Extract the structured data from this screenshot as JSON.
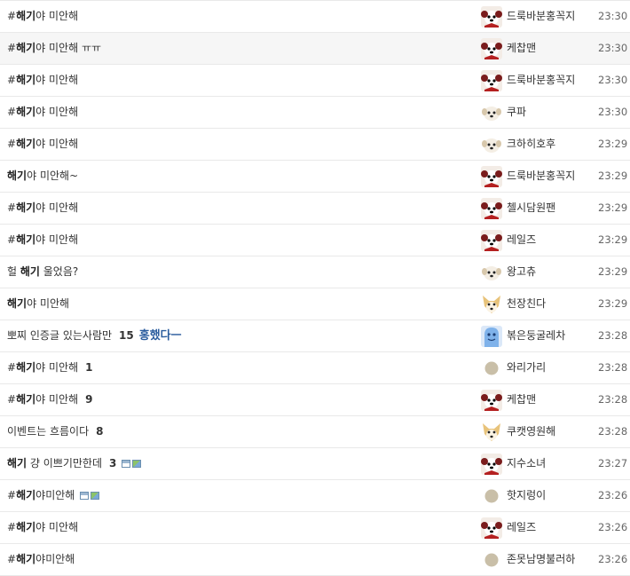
{
  "rows": [
    {
      "title": [
        {
          "t": "#"
        },
        {
          "t": "해기",
          "b": true
        },
        {
          "t": "야 미안해"
        }
      ],
      "count": "",
      "hot": "",
      "attach": false,
      "avatar": "dog-bow-icon",
      "nick": "드룩바분홍꼭지",
      "time": "23:30"
    },
    {
      "title": [
        {
          "t": "#"
        },
        {
          "t": "해기",
          "b": true
        },
        {
          "t": "야 미안해 ㅠㅠ"
        }
      ],
      "count": "",
      "hot": "",
      "attach": false,
      "avatar": "dog-bow-icon",
      "nick": "케찹맨",
      "time": "23:30",
      "hover": true
    },
    {
      "title": [
        {
          "t": "#"
        },
        {
          "t": "해기",
          "b": true
        },
        {
          "t": "야 미안해"
        }
      ],
      "count": "",
      "hot": "",
      "attach": false,
      "avatar": "dog-bow-icon",
      "nick": "드룩바분홍꼭지",
      "time": "23:30"
    },
    {
      "title": [
        {
          "t": "#"
        },
        {
          "t": "해기",
          "b": true
        },
        {
          "t": "야 미안해"
        }
      ],
      "count": "",
      "hot": "",
      "attach": false,
      "avatar": "puppy-icon",
      "nick": "쿠파",
      "time": "23:30"
    },
    {
      "title": [
        {
          "t": "#"
        },
        {
          "t": "해기",
          "b": true
        },
        {
          "t": "야 미안해"
        }
      ],
      "count": "",
      "hot": "",
      "attach": false,
      "avatar": "puppy-icon",
      "nick": "크하히호후",
      "time": "23:29"
    },
    {
      "title": [
        {
          "t": "해기",
          "b": true
        },
        {
          "t": "야 미안해~"
        }
      ],
      "count": "",
      "hot": "",
      "attach": false,
      "avatar": "dog-bow-icon",
      "nick": "드룩바분홍꼭지",
      "time": "23:29"
    },
    {
      "title": [
        {
          "t": "#"
        },
        {
          "t": "해기",
          "b": true
        },
        {
          "t": "야 미안해"
        }
      ],
      "count": "",
      "hot": "",
      "attach": false,
      "avatar": "dog-bow-icon",
      "nick": "첼시담원팬",
      "time": "23:29"
    },
    {
      "title": [
        {
          "t": "#"
        },
        {
          "t": "해기",
          "b": true
        },
        {
          "t": "야 미안해"
        }
      ],
      "count": "",
      "hot": "",
      "attach": false,
      "avatar": "dog-bow-icon",
      "nick": "레일즈",
      "time": "23:29"
    },
    {
      "title": [
        {
          "t": "헐 "
        },
        {
          "t": "해기",
          "b": true
        },
        {
          "t": " 울었음?"
        }
      ],
      "count": "",
      "hot": "",
      "attach": false,
      "avatar": "puppy-icon",
      "nick": "왕고츄",
      "time": "23:29"
    },
    {
      "title": [
        {
          "t": "해기",
          "b": true
        },
        {
          "t": "야 미안해"
        }
      ],
      "count": "",
      "hot": "",
      "attach": false,
      "avatar": "fox-dog-icon",
      "nick": "천장친다",
      "time": "23:29"
    },
    {
      "title": [
        {
          "t": "뽀찌 인증글 있는사람만"
        }
      ],
      "count": "15",
      "hot": "홍했다ㅡ",
      "attach": false,
      "avatar": "blue-ghost-icon",
      "nick": "볶은둥굴레차",
      "time": "23:28"
    },
    {
      "title": [
        {
          "t": "#"
        },
        {
          "t": "해기",
          "b": true
        },
        {
          "t": "야 미안해"
        }
      ],
      "count": "1",
      "hot": "",
      "attach": false,
      "avatar": "default-circle-icon",
      "nick": "와리가리",
      "time": "23:28"
    },
    {
      "title": [
        {
          "t": "#"
        },
        {
          "t": "해기",
          "b": true
        },
        {
          "t": "야 미안해"
        }
      ],
      "count": "9",
      "hot": "",
      "attach": false,
      "avatar": "dog-bow-icon",
      "nick": "케찹맨",
      "time": "23:28"
    },
    {
      "title": [
        {
          "t": "이벤트는 흐름이다"
        }
      ],
      "count": "8",
      "hot": "",
      "attach": false,
      "avatar": "fox-dog-icon",
      "nick": "쿠캣영원해",
      "time": "23:28"
    },
    {
      "title": [
        {
          "t": "해기",
          "b": true
        },
        {
          "t": " 걍 이쁘기만한데"
        }
      ],
      "count": "3",
      "hot": "",
      "attach": true,
      "avatar": "dog-bow-icon",
      "nick": "지수소녀",
      "time": "23:27"
    },
    {
      "title": [
        {
          "t": "#"
        },
        {
          "t": "해기",
          "b": true
        },
        {
          "t": "야미안해"
        }
      ],
      "count": "",
      "hot": "",
      "attach": true,
      "avatar": "default-circle-icon",
      "nick": "핫지렁이",
      "time": "23:26"
    },
    {
      "title": [
        {
          "t": "#"
        },
        {
          "t": "해기",
          "b": true
        },
        {
          "t": "야 미안해"
        }
      ],
      "count": "",
      "hot": "",
      "attach": false,
      "avatar": "dog-bow-icon",
      "nick": "레일즈",
      "time": "23:26"
    },
    {
      "title": [
        {
          "t": "#"
        },
        {
          "t": "해기",
          "b": true
        },
        {
          "t": "야미안해"
        }
      ],
      "count": "",
      "hot": "",
      "attach": false,
      "avatar": "default-circle-icon",
      "nick": "존못남명불러하",
      "time": "23:26"
    }
  ]
}
